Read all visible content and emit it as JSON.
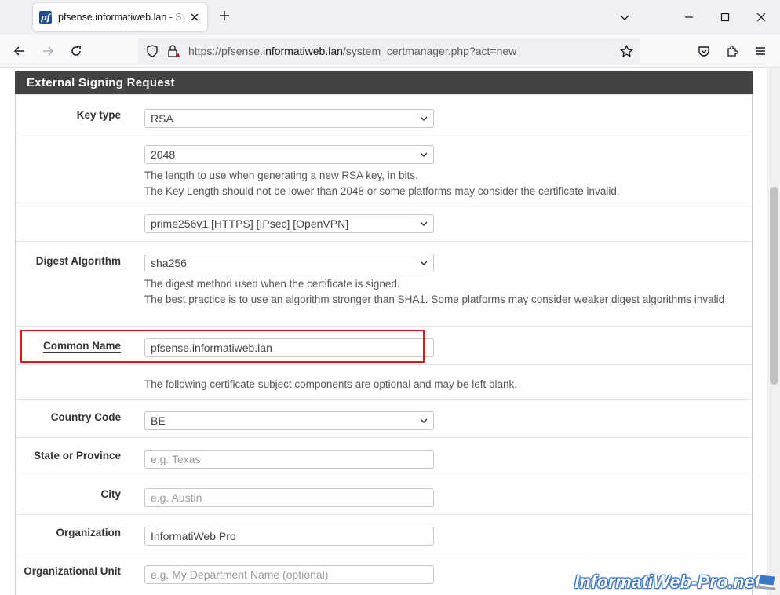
{
  "browser": {
    "tab_title": "pfsense.informatiweb.lan - System",
    "favicon_text": "pf",
    "url_prefix": "https://pfsense.",
    "url_host": "informatiweb.lan",
    "url_suffix": "/system_certmanager.php?act=new"
  },
  "panel": {
    "title": "External Signing Request"
  },
  "form": {
    "key_type": {
      "label": "Key type",
      "value": "RSA"
    },
    "key_length": {
      "value": "2048",
      "help1": "The length to use when generating a new RSA key, in bits.",
      "help2": "The Key Length should not be lower than 2048 or some platforms may consider the certificate invalid."
    },
    "ecname": {
      "value": "prime256v1 [HTTPS] [IPsec] [OpenVPN]"
    },
    "digest": {
      "label": "Digest Algorithm",
      "value": "sha256",
      "help1": "The digest method used when the certificate is signed.",
      "help2": "The best practice is to use an algorithm stronger than SHA1. Some platforms may consider weaker digest algorithms invalid"
    },
    "common_name": {
      "label": "Common Name",
      "value": "pfsense.informatiweb.lan"
    },
    "optional_note": "The following certificate subject components are optional and may be left blank.",
    "country": {
      "label": "Country Code",
      "value": "BE"
    },
    "state": {
      "label": "State or Province",
      "placeholder": "e.g. Texas"
    },
    "city": {
      "label": "City",
      "placeholder": "e.g. Austin"
    },
    "organization": {
      "label": "Organization",
      "value": "InformatiWeb Pro"
    },
    "org_unit": {
      "label": "Organizational Unit",
      "placeholder": "e.g. My Department Name (optional)"
    }
  },
  "watermark": "InformatiWeb-Pro.net",
  "colors": {
    "panel_header": "#424242",
    "highlight": "#d81a1a",
    "watermark": "#2c6ab5"
  }
}
